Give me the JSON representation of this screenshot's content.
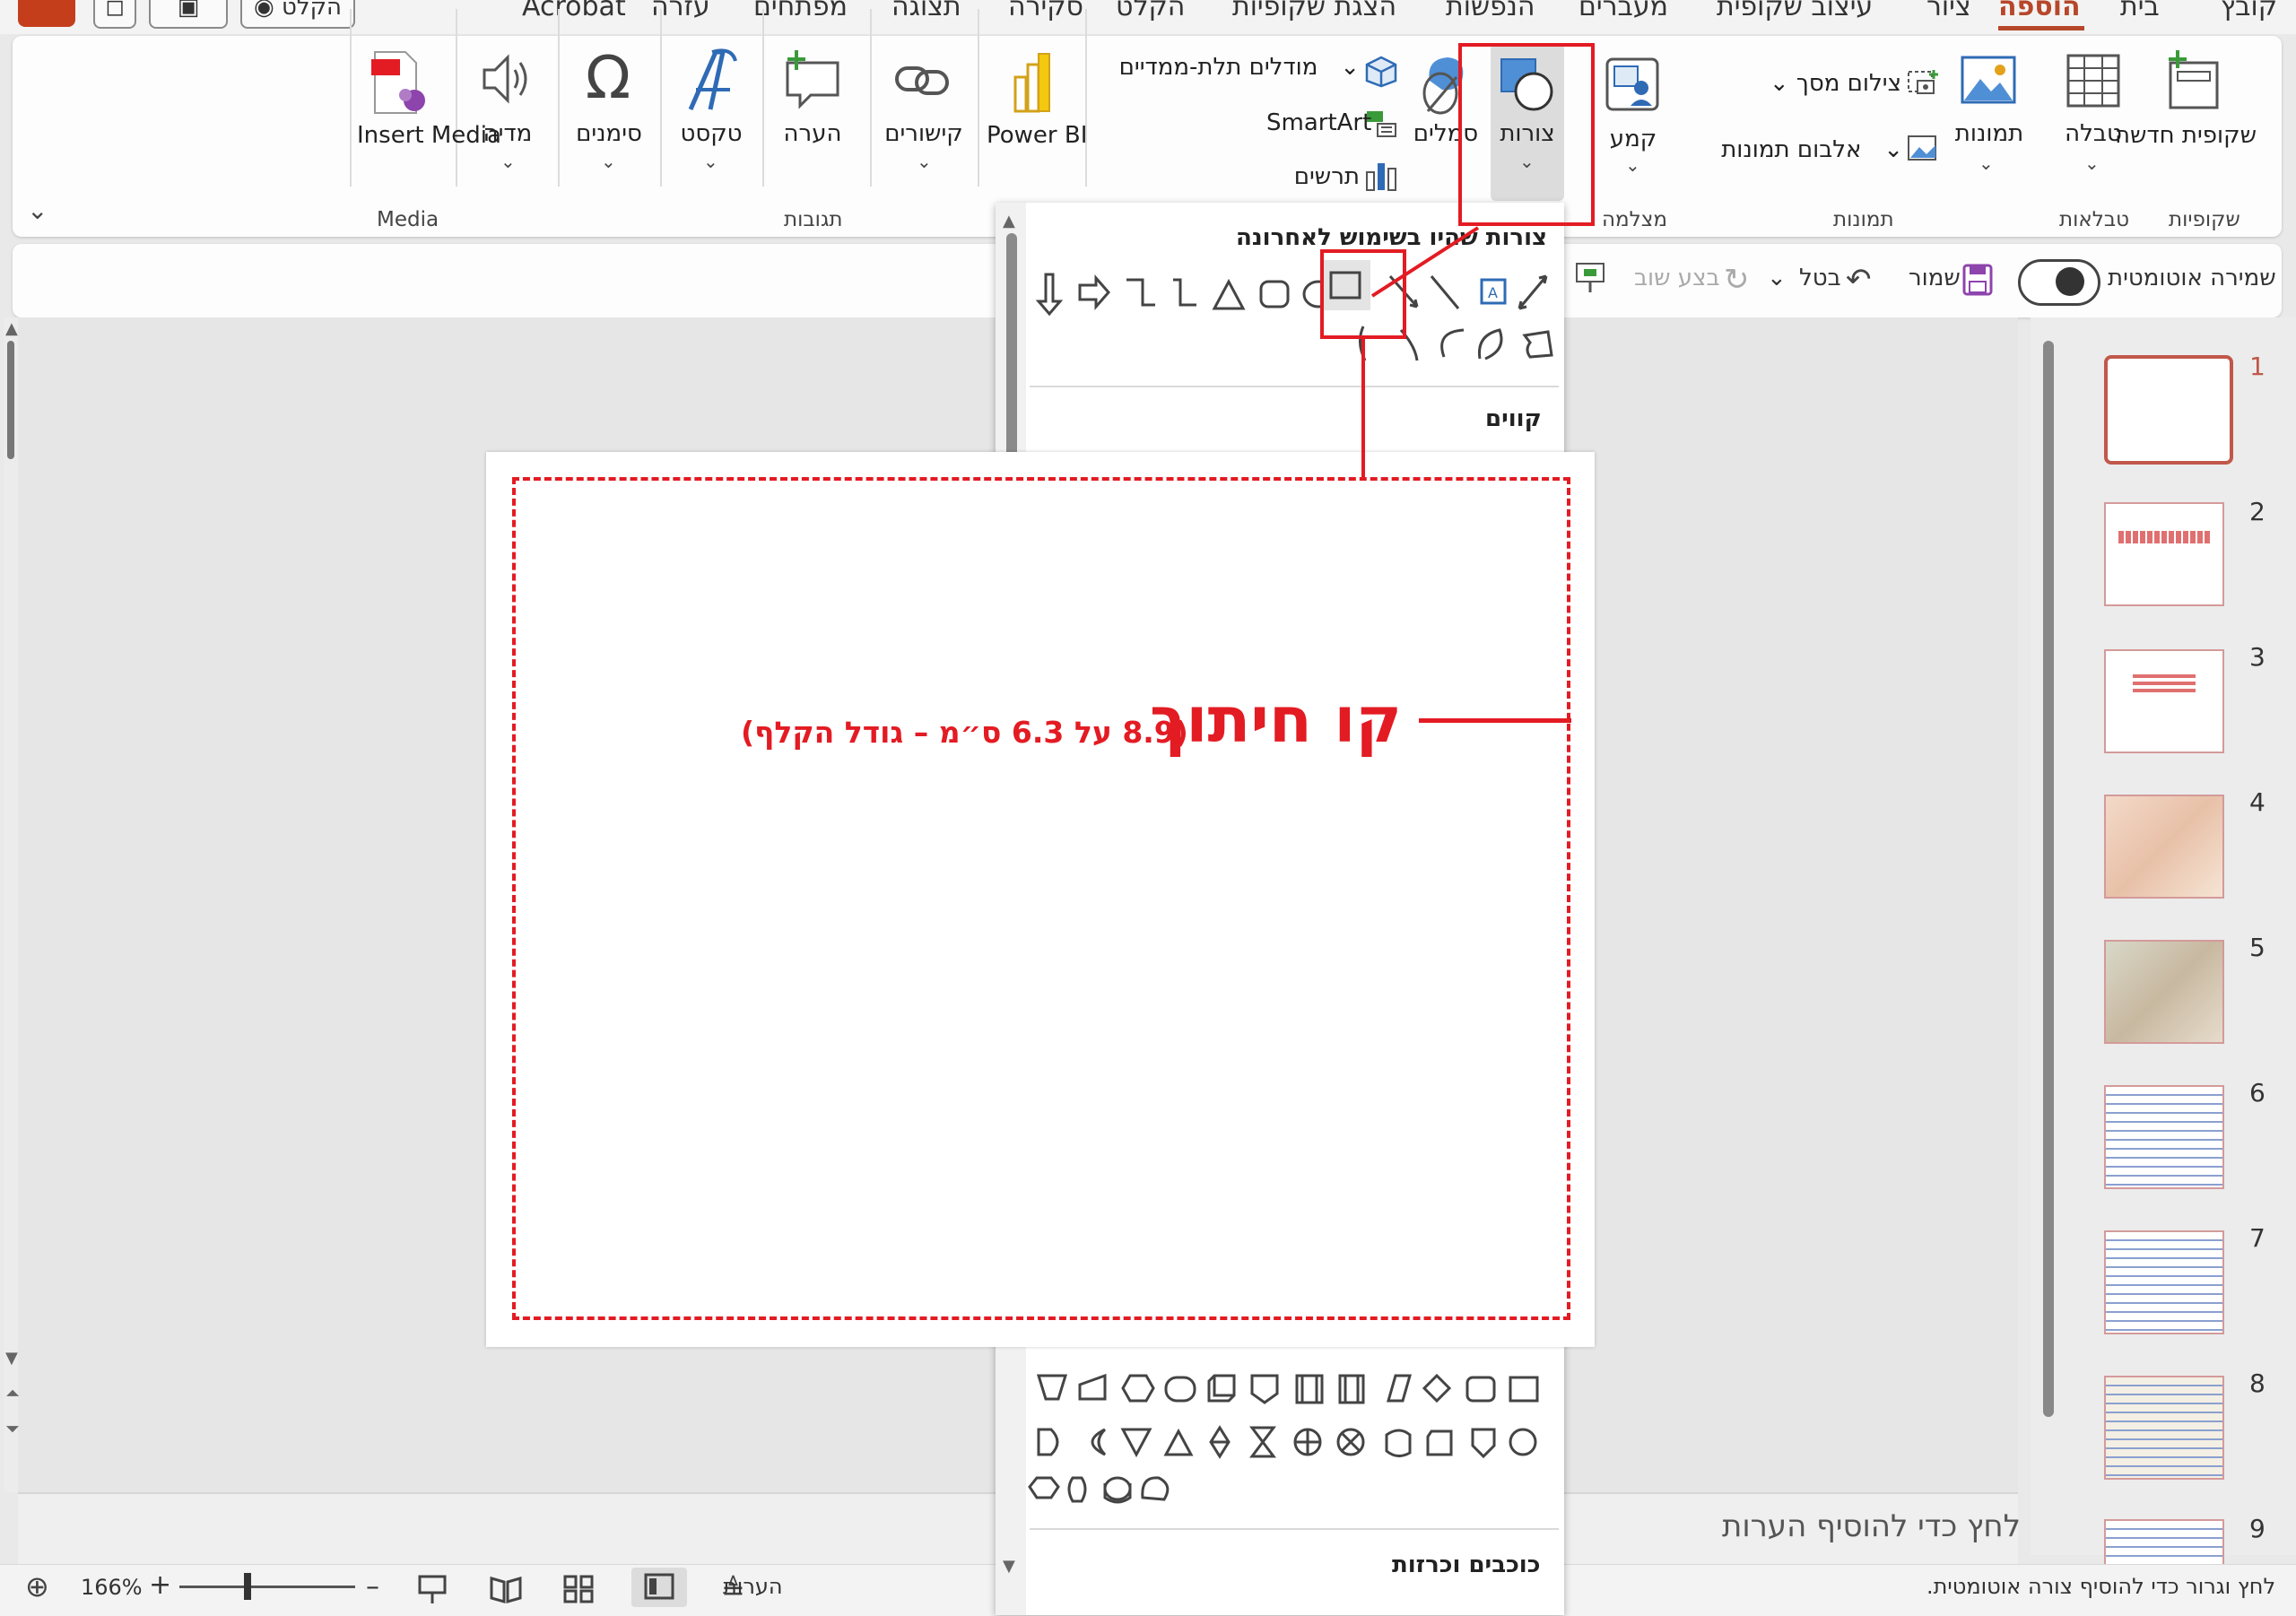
{
  "menu": {
    "tabs": [
      "קובץ",
      "בית",
      "הוספה",
      "ציור",
      "עיצוב שקופית",
      "מעברים",
      "הנפשות",
      "הצגת שקופיות",
      "הקלט",
      "סקירה",
      "תצוגה",
      "מפתחים",
      "עזרה",
      "Acrobat"
    ],
    "record_button": "הקלט"
  },
  "ribbon": {
    "new_slide": "שקופית חדשה",
    "table": "טבלה",
    "pictures": "תמונות",
    "screenshot": "צילום מסך",
    "photo_album": "אלבום תמונות",
    "cameo": "קמע",
    "shapes": "צורות",
    "icons": "סמלים",
    "models_3d": "מודלים תלת-ממדיים",
    "smartart": "SmartArt",
    "chart": "תרשים",
    "power_bi": "Power BI",
    "links": "קישורים",
    "comment": "הערה",
    "text": "טקסט",
    "symbols": "סימנים",
    "media": "מדיה",
    "insert_media": "Insert Media",
    "groups": {
      "slides": "שקופיות",
      "tables": "טבלאות",
      "images": "תמונות",
      "camera": "מצלמה",
      "comments": "תגובות",
      "media": "Media"
    }
  },
  "qat": {
    "autosave": "שמירה אוטומטית",
    "save": "שמור",
    "undo": "בטל",
    "redo": "בצע שוב"
  },
  "gallery": {
    "recent_header": "צורות שהיו בשימוש לאחרונה",
    "lines_header": "קווים",
    "stars_header": "כוכבים וכרזות"
  },
  "overlay": {
    "title": "קו חיתוך",
    "subtitle": "(8.9 על 6.3 ס״מ – גודל הקלף)"
  },
  "slides": {
    "numbers": [
      "1",
      "2",
      "3",
      "4",
      "5",
      "6",
      "7",
      "8",
      "9"
    ]
  },
  "notes": {
    "placeholder": "לחץ כדי להוסיף הערות"
  },
  "status": {
    "hint": "לחץ וגרור כדי להוסיף צורה אוטומטית.",
    "notes_button": "הערות",
    "zoom": "166%"
  },
  "colors": {
    "accent": "#b7472a",
    "annotation_red": "#e31b23"
  }
}
